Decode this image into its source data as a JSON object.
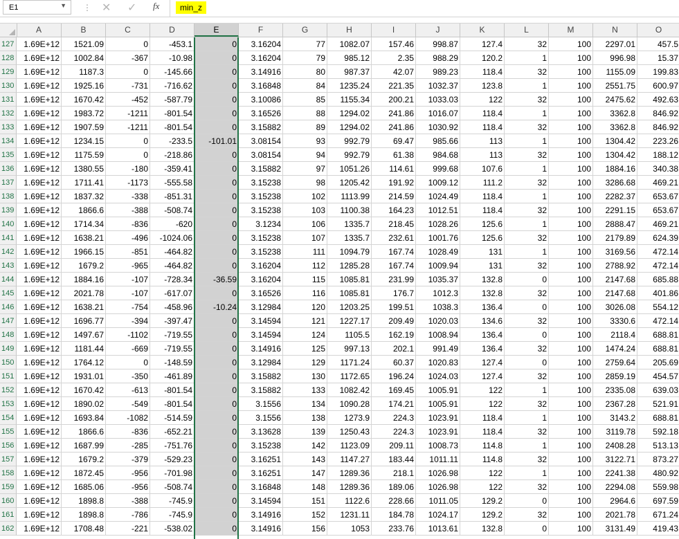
{
  "formula_bar": {
    "name_box": "E1",
    "cancel_icon": "✕",
    "enter_icon": "✓",
    "fx_label": "fx",
    "content": "min_z"
  },
  "columns": [
    "A",
    "B",
    "C",
    "D",
    "E",
    "F",
    "G",
    "H",
    "I",
    "J",
    "K",
    "L",
    "M",
    "N",
    "O"
  ],
  "selected_column": "E",
  "rows": [
    {
      "n": "127",
      "v": [
        "1.69E+12",
        "1521.09",
        "0",
        "-453.1",
        "0",
        "3.16204",
        "77",
        "1082.07",
        "157.46",
        "998.87",
        "127.4",
        "32",
        "100",
        "2297.01",
        "457.5"
      ]
    },
    {
      "n": "128",
      "v": [
        "1.69E+12",
        "1002.84",
        "-367",
        "-10.98",
        "0",
        "3.16204",
        "79",
        "985.12",
        "2.35",
        "988.29",
        "120.2",
        "1",
        "100",
        "996.98",
        "15.37"
      ]
    },
    {
      "n": "129",
      "v": [
        "1.69E+12",
        "1187.3",
        "0",
        "-145.66",
        "0",
        "3.14916",
        "80",
        "987.37",
        "42.07",
        "989.23",
        "118.4",
        "32",
        "100",
        "1155.09",
        "199.83"
      ]
    },
    {
      "n": "130",
      "v": [
        "1.69E+12",
        "1925.16",
        "-731",
        "-716.62",
        "0",
        "3.16848",
        "84",
        "1235.24",
        "221.35",
        "1032.37",
        "123.8",
        "1",
        "100",
        "2551.75",
        "600.97"
      ]
    },
    {
      "n": "131",
      "v": [
        "1.69E+12",
        "1670.42",
        "-452",
        "-587.79",
        "0",
        "3.10086",
        "85",
        "1155.34",
        "200.21",
        "1033.03",
        "122",
        "32",
        "100",
        "2475.62",
        "492.63"
      ]
    },
    {
      "n": "132",
      "v": [
        "1.69E+12",
        "1983.72",
        "-1211",
        "-801.54",
        "0",
        "3.16526",
        "88",
        "1294.02",
        "241.86",
        "1016.07",
        "118.4",
        "1",
        "100",
        "3362.8",
        "846.92"
      ]
    },
    {
      "n": "133",
      "v": [
        "1.69E+12",
        "1907.59",
        "-1211",
        "-801.54",
        "0",
        "3.15882",
        "89",
        "1294.02",
        "241.86",
        "1030.92",
        "118.4",
        "32",
        "100",
        "3362.8",
        "846.92"
      ]
    },
    {
      "n": "134",
      "v": [
        "1.69E+12",
        "1234.15",
        "0",
        "-233.5",
        "-101.01",
        "3.08154",
        "93",
        "992.79",
        "69.47",
        "985.66",
        "113",
        "1",
        "100",
        "1304.42",
        "223.26"
      ]
    },
    {
      "n": "135",
      "v": [
        "1.69E+12",
        "1175.59",
        "0",
        "-218.86",
        "0",
        "3.08154",
        "94",
        "992.79",
        "61.38",
        "984.68",
        "113",
        "32",
        "100",
        "1304.42",
        "188.12"
      ]
    },
    {
      "n": "136",
      "v": [
        "1.69E+12",
        "1380.55",
        "-180",
        "-359.41",
        "0",
        "3.15882",
        "97",
        "1051.26",
        "114.61",
        "999.68",
        "107.6",
        "1",
        "100",
        "1884.16",
        "340.38"
      ]
    },
    {
      "n": "137",
      "v": [
        "1.69E+12",
        "1711.41",
        "-1173",
        "-555.58",
        "0",
        "3.15238",
        "98",
        "1205.42",
        "191.92",
        "1009.12",
        "111.2",
        "32",
        "100",
        "3286.68",
        "469.21"
      ]
    },
    {
      "n": "138",
      "v": [
        "1.69E+12",
        "1837.32",
        "-338",
        "-851.31",
        "0",
        "3.15238",
        "102",
        "1113.99",
        "214.59",
        "1024.49",
        "118.4",
        "1",
        "100",
        "2282.37",
        "653.67"
      ]
    },
    {
      "n": "139",
      "v": [
        "1.69E+12",
        "1866.6",
        "-388",
        "-508.74",
        "0",
        "3.15238",
        "103",
        "1100.38",
        "164.23",
        "1012.51",
        "118.4",
        "32",
        "100",
        "2291.15",
        "653.67"
      ]
    },
    {
      "n": "140",
      "v": [
        "1.69E+12",
        "1714.34",
        "-836",
        "-620",
        "0",
        "3.1234",
        "106",
        "1335.7",
        "218.45",
        "1028.26",
        "125.6",
        "1",
        "100",
        "2888.47",
        "469.21"
      ]
    },
    {
      "n": "141",
      "v": [
        "1.69E+12",
        "1638.21",
        "-496",
        "-1024.06",
        "0",
        "3.15238",
        "107",
        "1335.7",
        "232.61",
        "1001.76",
        "125.6",
        "32",
        "100",
        "2179.89",
        "624.39"
      ]
    },
    {
      "n": "142",
      "v": [
        "1.69E+12",
        "1966.15",
        "-851",
        "-464.82",
        "0",
        "3.15238",
        "111",
        "1094.79",
        "167.74",
        "1028.49",
        "131",
        "1",
        "100",
        "3169.56",
        "472.14"
      ]
    },
    {
      "n": "143",
      "v": [
        "1.69E+12",
        "1679.2",
        "-965",
        "-464.82",
        "0",
        "3.16204",
        "112",
        "1285.28",
        "167.74",
        "1009.94",
        "131",
        "32",
        "100",
        "2788.92",
        "472.14"
      ]
    },
    {
      "n": "144",
      "v": [
        "1.69E+12",
        "1884.16",
        "-107",
        "-728.34",
        "-36.59",
        "3.16204",
        "115",
        "1085.81",
        "231.99",
        "1035.37",
        "132.8",
        "0",
        "100",
        "2147.68",
        "685.88"
      ]
    },
    {
      "n": "145",
      "v": [
        "1.69E+12",
        "2021.78",
        "-107",
        "-617.07",
        "0",
        "3.16526",
        "116",
        "1085.81",
        "176.7",
        "1012.3",
        "132.8",
        "32",
        "100",
        "2147.68",
        "401.86"
      ]
    },
    {
      "n": "146",
      "v": [
        "1.69E+12",
        "1638.21",
        "-754",
        "-458.96",
        "-10.24",
        "3.12984",
        "120",
        "1203.25",
        "199.51",
        "1038.3",
        "136.4",
        "0",
        "100",
        "3026.08",
        "554.12"
      ]
    },
    {
      "n": "147",
      "v": [
        "1.69E+12",
        "1696.77",
        "-394",
        "-397.47",
        "0",
        "3.14594",
        "121",
        "1227.17",
        "209.49",
        "1020.03",
        "134.6",
        "32",
        "100",
        "3330.6",
        "472.14"
      ]
    },
    {
      "n": "148",
      "v": [
        "1.69E+12",
        "1497.67",
        "-1102",
        "-719.55",
        "0",
        "3.14594",
        "124",
        "1105.5",
        "162.19",
        "1008.94",
        "136.4",
        "0",
        "100",
        "2118.4",
        "688.81"
      ]
    },
    {
      "n": "149",
      "v": [
        "1.69E+12",
        "1181.44",
        "-669",
        "-719.55",
        "0",
        "3.14916",
        "125",
        "997.13",
        "202.1",
        "991.49",
        "136.4",
        "32",
        "100",
        "1474.24",
        "688.81"
      ]
    },
    {
      "n": "150",
      "v": [
        "1.69E+12",
        "1764.12",
        "0",
        "-148.59",
        "0",
        "3.12984",
        "129",
        "1171.24",
        "60.37",
        "1020.83",
        "127.4",
        "0",
        "100",
        "2759.64",
        "205.69"
      ]
    },
    {
      "n": "151",
      "v": [
        "1.69E+12",
        "1931.01",
        "-350",
        "-461.89",
        "0",
        "3.15882",
        "130",
        "1172.65",
        "196.24",
        "1024.03",
        "127.4",
        "32",
        "100",
        "2859.19",
        "454.57"
      ]
    },
    {
      "n": "152",
      "v": [
        "1.69E+12",
        "1670.42",
        "-613",
        "-801.54",
        "0",
        "3.15882",
        "133",
        "1082.42",
        "169.45",
        "1005.91",
        "122",
        "1",
        "100",
        "2335.08",
        "639.03"
      ]
    },
    {
      "n": "153",
      "v": [
        "1.69E+12",
        "1890.02",
        "-549",
        "-801.54",
        "0",
        "3.1556",
        "134",
        "1090.28",
        "174.21",
        "1005.91",
        "122",
        "32",
        "100",
        "2367.28",
        "521.91"
      ]
    },
    {
      "n": "154",
      "v": [
        "1.69E+12",
        "1693.84",
        "-1082",
        "-514.59",
        "0",
        "3.1556",
        "138",
        "1273.9",
        "224.3",
        "1023.91",
        "118.4",
        "1",
        "100",
        "3143.2",
        "688.81"
      ]
    },
    {
      "n": "155",
      "v": [
        "1.69E+12",
        "1866.6",
        "-836",
        "-652.21",
        "0",
        "3.13628",
        "139",
        "1250.43",
        "224.3",
        "1023.91",
        "118.4",
        "32",
        "100",
        "3119.78",
        "592.18"
      ]
    },
    {
      "n": "156",
      "v": [
        "1.69E+12",
        "1687.99",
        "-285",
        "-751.76",
        "0",
        "3.15238",
        "142",
        "1123.09",
        "209.11",
        "1008.73",
        "114.8",
        "1",
        "100",
        "2408.28",
        "513.13"
      ]
    },
    {
      "n": "157",
      "v": [
        "1.69E+12",
        "1679.2",
        "-379",
        "-529.23",
        "0",
        "3.16251",
        "143",
        "1147.27",
        "183.44",
        "1011.11",
        "114.8",
        "32",
        "100",
        "3122.71",
        "873.27"
      ]
    },
    {
      "n": "158",
      "v": [
        "1.69E+12",
        "1872.45",
        "-956",
        "-701.98",
        "0",
        "3.16251",
        "147",
        "1289.36",
        "218.1",
        "1026.98",
        "122",
        "1",
        "100",
        "2241.38",
        "480.92"
      ]
    },
    {
      "n": "159",
      "v": [
        "1.69E+12",
        "1685.06",
        "-956",
        "-508.74",
        "0",
        "3.16848",
        "148",
        "1289.36",
        "189.06",
        "1026.98",
        "122",
        "32",
        "100",
        "2294.08",
        "559.98"
      ]
    },
    {
      "n": "160",
      "v": [
        "1.69E+12",
        "1898.8",
        "-388",
        "-745.9",
        "0",
        "3.14594",
        "151",
        "1122.6",
        "228.66",
        "1011.05",
        "129.2",
        "0",
        "100",
        "2964.6",
        "697.59"
      ]
    },
    {
      "n": "161",
      "v": [
        "1.69E+12",
        "1898.8",
        "-786",
        "-745.9",
        "0",
        "3.14916",
        "152",
        "1231.11",
        "184.78",
        "1024.17",
        "129.2",
        "32",
        "100",
        "2021.78",
        "671.24"
      ]
    },
    {
      "n": "162",
      "v": [
        "1.69E+12",
        "1708.48",
        "-221",
        "-538.02",
        "0",
        "3.14916",
        "156",
        "1053",
        "233.76",
        "1013.61",
        "132.8",
        "0",
        "100",
        "3131.49",
        "419.43"
      ]
    }
  ]
}
